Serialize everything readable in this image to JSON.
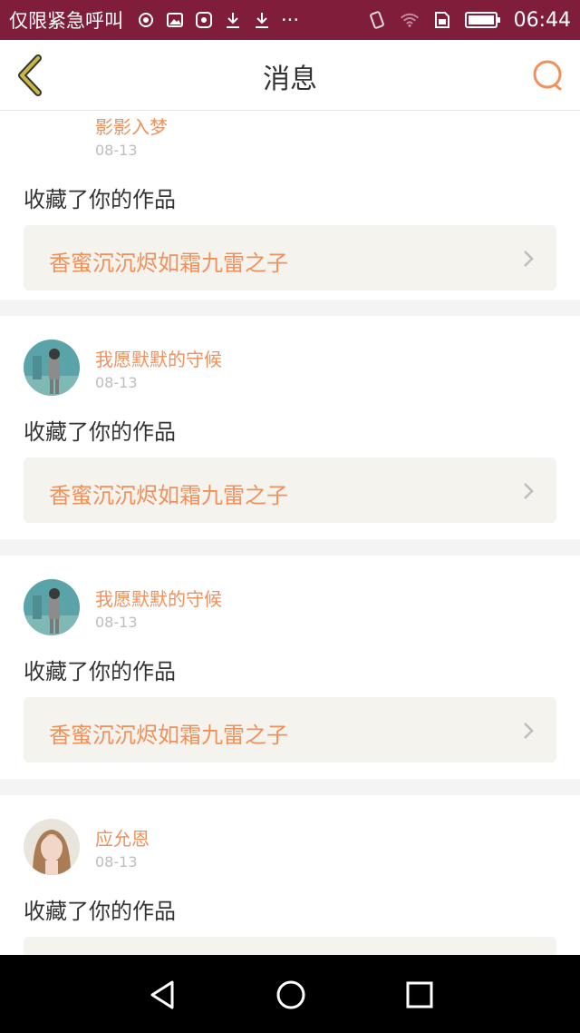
{
  "status_bar": {
    "carrier": "仅限紧急呼叫",
    "time": "06:44",
    "left_icons": [
      "location-icon",
      "image-icon",
      "app-icon",
      "download-icon",
      "download-icon",
      "more-dots-icon"
    ],
    "right_icons": [
      "vibrate-icon",
      "wifi-icon",
      "sim-icon",
      "battery-icon"
    ],
    "more_dots": "···"
  },
  "header": {
    "title": "消息",
    "back_icon": "back-chevron-icon",
    "search_icon": "search-icon"
  },
  "messages": [
    {
      "user": "影影入梦",
      "date": "08-13",
      "action": "收藏了你的作品",
      "work_title": "香蜜沉沉烬如霜九雷之子"
    },
    {
      "user": "我愿默默的守候",
      "date": "08-13",
      "action": "收藏了你的作品",
      "work_title": "香蜜沉沉烬如霜九雷之子"
    },
    {
      "user": "我愿默默的守候",
      "date": "08-13",
      "action": "收藏了你的作品",
      "work_title": "香蜜沉沉烬如霜九雷之子"
    },
    {
      "user": "应允恩",
      "date": "08-13",
      "action": "收藏了你的作品",
      "work_title": ""
    }
  ],
  "colors": {
    "accent": "#f0905a",
    "status_bar": "#7f1d3b",
    "back_icon": "#b3a43a",
    "card_inner": "#f5f3ed"
  }
}
